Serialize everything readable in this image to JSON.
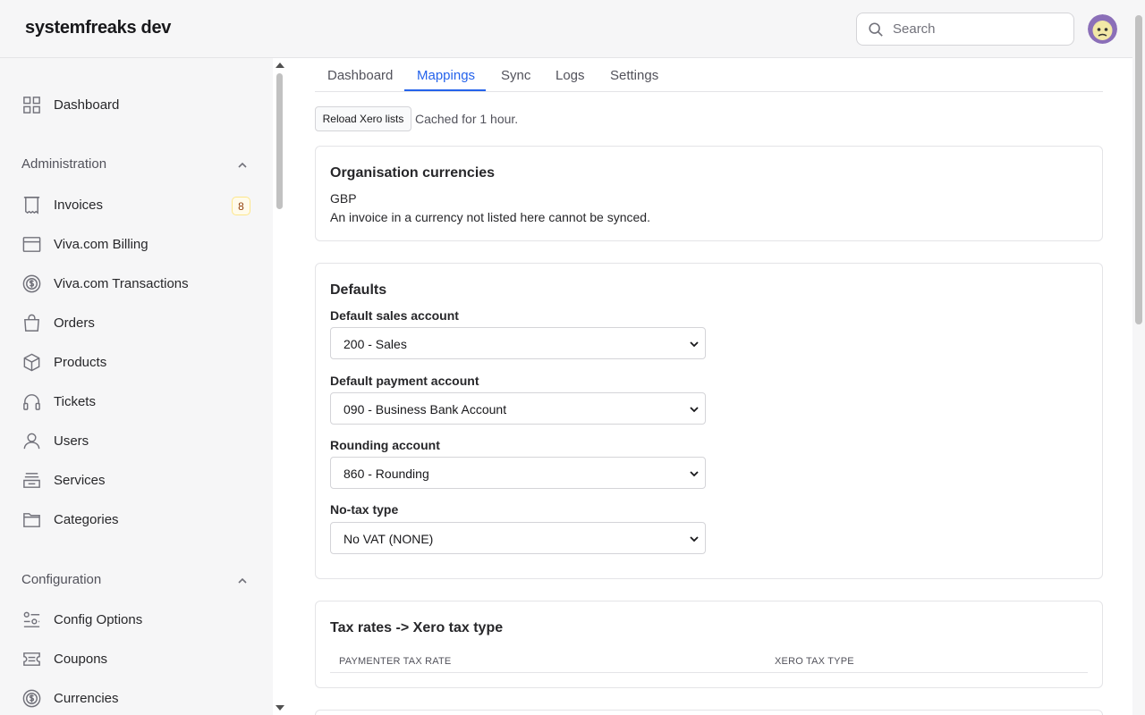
{
  "header": {
    "brand": "systemfreaks dev",
    "search_placeholder": "Search",
    "avatar_icon": "avatar-face-icon"
  },
  "sidebar": {
    "dashboard": {
      "label": "Dashboard",
      "icon": "grid-icon"
    },
    "sections": [
      {
        "title": "Administration",
        "items": [
          {
            "label": "Invoices",
            "icon": "receipt-icon",
            "badge": "8"
          },
          {
            "label": "Viva.com Billing",
            "icon": "card-icon"
          },
          {
            "label": "Viva.com Transactions",
            "icon": "dollar-circle-icon"
          },
          {
            "label": "Orders",
            "icon": "shopping-bag-icon"
          },
          {
            "label": "Products",
            "icon": "cube-icon"
          },
          {
            "label": "Tickets",
            "icon": "headset-icon"
          },
          {
            "label": "Users",
            "icon": "user-icon"
          },
          {
            "label": "Services",
            "icon": "stack-icon"
          },
          {
            "label": "Categories",
            "icon": "folder-icon"
          }
        ]
      },
      {
        "title": "Configuration",
        "items": [
          {
            "label": "Config Options",
            "icon": "sliders-icon"
          },
          {
            "label": "Coupons",
            "icon": "ticket-icon"
          },
          {
            "label": "Currencies",
            "icon": "dollar-circle-icon"
          }
        ]
      }
    ]
  },
  "tabs": [
    {
      "label": "Dashboard"
    },
    {
      "label": "Mappings",
      "active": true
    },
    {
      "label": "Sync"
    },
    {
      "label": "Logs"
    },
    {
      "label": "Settings"
    }
  ],
  "toolbar": {
    "reload_label": "Reload Xero lists",
    "cached_text": "Cached for 1 hour."
  },
  "currencies_card": {
    "title": "Organisation currencies",
    "currency": "GBP",
    "note": "An invoice in a currency not listed here cannot be synced."
  },
  "defaults_card": {
    "title": "Defaults",
    "fields": [
      {
        "label": "Default sales account",
        "value": "200 - Sales"
      },
      {
        "label": "Default payment account",
        "value": "090 - Business Bank Account"
      },
      {
        "label": "Rounding account",
        "value": "860 - Rounding"
      },
      {
        "label": "No-tax type",
        "value": "No VAT (NONE)"
      }
    ]
  },
  "tax_card": {
    "title": "Tax rates -> Xero tax type",
    "columns": [
      "PAYMENTER TAX RATE",
      "XERO TAX TYPE"
    ]
  },
  "colors": {
    "accent": "#2563eb",
    "badge_bg": "#fffbeb",
    "badge_text": "#92400e"
  }
}
